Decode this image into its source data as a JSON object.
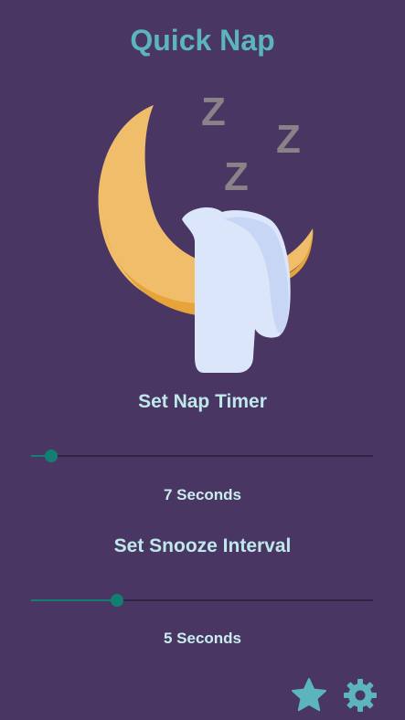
{
  "app": {
    "title": "Quick Nap"
  },
  "hero": {
    "icon": "sleeping-moon-illustration"
  },
  "nap_timer": {
    "label": "Set Nap Timer",
    "value_text": "7 Seconds",
    "fraction": 0.06
  },
  "snooze": {
    "label": "Set Snooze Interval",
    "value_text": "5 Seconds",
    "fraction": 0.25
  },
  "footer": {
    "favorite_icon": "star-icon",
    "settings_icon": "gear-icon"
  },
  "colors": {
    "background": "#4a3663",
    "accent": "#5bb5bb",
    "slider_active": "#137f72",
    "moon": "#f0be6a"
  }
}
